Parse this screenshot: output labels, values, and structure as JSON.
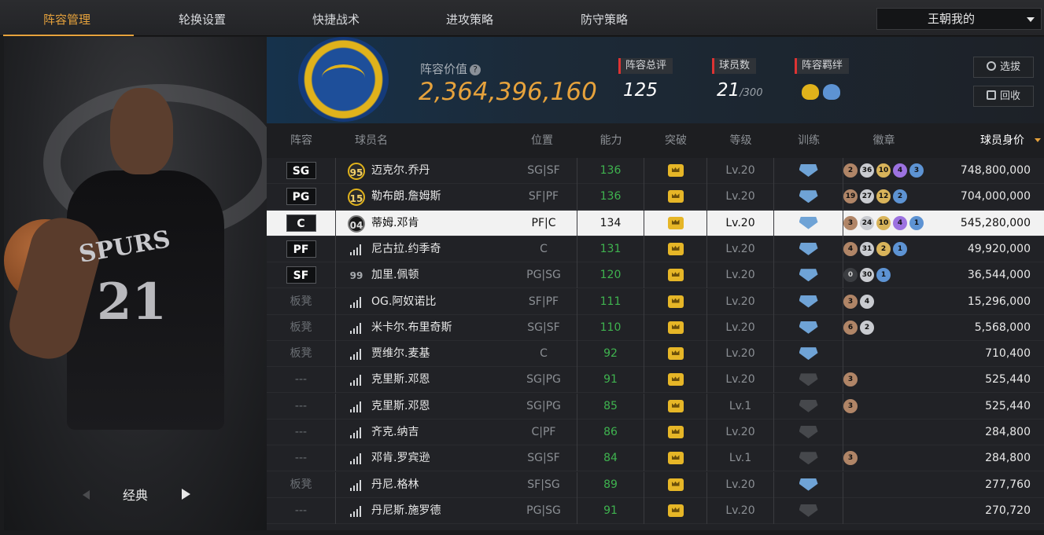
{
  "tabs": [
    "阵容管理",
    "轮换设置",
    "快捷战术",
    "进攻策略",
    "防守策略"
  ],
  "active_tab": 0,
  "team_selector": "王朝我的",
  "left_panel": {
    "jersey_team": "SPURS",
    "jersey_number": "21",
    "style_label": "经典"
  },
  "team": {
    "value_label": "阵容价值",
    "value": "2,364,396,160",
    "overall_label": "阵容总评",
    "overall": "125",
    "players_label": "球员数",
    "players_count": "21",
    "players_max": "/300",
    "bond_label": "阵容羁绊",
    "select_button": "选拔",
    "recycle_button": "回收"
  },
  "columns": {
    "slot": "阵容",
    "name": "球员名",
    "position": "位置",
    "ability": "能力",
    "breakthrough": "突破",
    "level": "等级",
    "training": "训练",
    "badges": "徽章",
    "price": "球员身价"
  },
  "badge_colors": {
    "bronze": "#b08567",
    "silver": "#c9cbd0",
    "gold": "#d9b45a",
    "purple": "#9c72e0",
    "blue": "#5d93d3",
    "dark": "#3b3d41"
  },
  "players": [
    {
      "slot": "SG",
      "slot_type": "box",
      "rank": "95",
      "rank_type": "gold",
      "name": "迈克尔.乔丹",
      "position": "SG|SF",
      "ability": "136",
      "level": "Lv.20",
      "train": true,
      "badges": [
        {
          "c": "bronze",
          "n": "2"
        },
        {
          "c": "silver",
          "n": "36"
        },
        {
          "c": "gold",
          "n": "10"
        },
        {
          "c": "purple",
          "n": "4"
        },
        {
          "c": "blue",
          "n": "3"
        }
      ],
      "price": "748,800,000"
    },
    {
      "slot": "PG",
      "slot_type": "box",
      "rank": "15",
      "rank_type": "gold",
      "name": "勒布朗.詹姆斯",
      "position": "SF|PF",
      "ability": "136",
      "level": "Lv.20",
      "train": true,
      "badges": [
        {
          "c": "bronze",
          "n": "19"
        },
        {
          "c": "silver",
          "n": "27"
        },
        {
          "c": "gold",
          "n": "12"
        },
        {
          "c": "blue",
          "n": "2"
        }
      ],
      "price": "704,000,000"
    },
    {
      "slot": "C",
      "slot_type": "box",
      "rank": "04",
      "rank_type": "dark",
      "name": "蒂姆.邓肯",
      "position": "PF|C",
      "ability": "134",
      "level": "Lv.20",
      "train": true,
      "selected": true,
      "badges": [
        {
          "c": "bronze",
          "n": "3"
        },
        {
          "c": "silver",
          "n": "24"
        },
        {
          "c": "gold",
          "n": "10"
        },
        {
          "c": "purple",
          "n": "4"
        },
        {
          "c": "blue",
          "n": "1"
        }
      ],
      "price": "545,280,000"
    },
    {
      "slot": "PF",
      "slot_type": "box",
      "rank": "",
      "rank_type": "bars",
      "name": "尼古拉.约季奇",
      "position": "C",
      "ability": "131",
      "level": "Lv.20",
      "train": true,
      "badges": [
        {
          "c": "bronze",
          "n": "4"
        },
        {
          "c": "silver",
          "n": "31"
        },
        {
          "c": "gold",
          "n": "2"
        },
        {
          "c": "blue",
          "n": "1"
        }
      ],
      "price": "49,920,000"
    },
    {
      "slot": "SF",
      "slot_type": "box",
      "rank": "99",
      "rank_type": "plain",
      "name": "加里.佩顿",
      "position": "PG|SG",
      "ability": "120",
      "level": "Lv.20",
      "train": true,
      "badges": [
        {
          "c": "dark",
          "n": "0"
        },
        {
          "c": "silver",
          "n": "30"
        },
        {
          "c": "blue",
          "n": "1"
        }
      ],
      "price": "36,544,000"
    },
    {
      "slot": "板凳",
      "slot_type": "text",
      "rank": "",
      "rank_type": "bars",
      "name": "OG.阿奴诺比",
      "position": "SF|PF",
      "ability": "111",
      "level": "Lv.20",
      "train": true,
      "badges": [
        {
          "c": "bronze",
          "n": "3"
        },
        {
          "c": "silver",
          "n": "4"
        }
      ],
      "price": "15,296,000"
    },
    {
      "slot": "板凳",
      "slot_type": "text",
      "rank": "",
      "rank_type": "bars",
      "name": "米卡尔.布里奇斯",
      "position": "SG|SF",
      "ability": "110",
      "level": "Lv.20",
      "train": true,
      "badges": [
        {
          "c": "bronze",
          "n": "6"
        },
        {
          "c": "silver",
          "n": "2"
        }
      ],
      "price": "5,568,000"
    },
    {
      "slot": "板凳",
      "slot_type": "text",
      "rank": "",
      "rank_type": "bars",
      "name": "贾维尔.麦基",
      "position": "C",
      "ability": "92",
      "level": "Lv.20",
      "train": true,
      "badges": [],
      "price": "710,400"
    },
    {
      "slot": "---",
      "slot_type": "text",
      "rank": "",
      "rank_type": "bars",
      "name": "克里斯.邓恩",
      "position": "SG|PG",
      "ability": "91",
      "level": "Lv.20",
      "train": false,
      "badges": [
        {
          "c": "bronze",
          "n": "3"
        }
      ],
      "price": "525,440"
    },
    {
      "slot": "---",
      "slot_type": "text",
      "rank": "",
      "rank_type": "bars",
      "name": "克里斯.邓恩",
      "position": "SG|PG",
      "ability": "85",
      "level": "Lv.1",
      "train": false,
      "badges": [
        {
          "c": "bronze",
          "n": "3"
        }
      ],
      "price": "525,440"
    },
    {
      "slot": "---",
      "slot_type": "text",
      "rank": "",
      "rank_type": "bars",
      "name": "齐克.纳吉",
      "position": "C|PF",
      "ability": "86",
      "level": "Lv.20",
      "train": false,
      "badges": [],
      "price": "284,800"
    },
    {
      "slot": "---",
      "slot_type": "text",
      "rank": "",
      "rank_type": "bars",
      "name": "邓肯.罗宾逊",
      "position": "SG|SF",
      "ability": "84",
      "level": "Lv.1",
      "train": false,
      "badges": [
        {
          "c": "bronze",
          "n": "3"
        }
      ],
      "price": "284,800"
    },
    {
      "slot": "板凳",
      "slot_type": "text",
      "rank": "",
      "rank_type": "bars",
      "name": "丹尼.格林",
      "position": "SF|SG",
      "ability": "89",
      "level": "Lv.20",
      "train": true,
      "badges": [],
      "price": "277,760"
    },
    {
      "slot": "---",
      "slot_type": "text",
      "rank": "",
      "rank_type": "bars",
      "name": "丹尼斯.施罗德",
      "position": "PG|SG",
      "ability": "91",
      "level": "Lv.20",
      "train": false,
      "badges": [],
      "price": "270,720"
    }
  ]
}
